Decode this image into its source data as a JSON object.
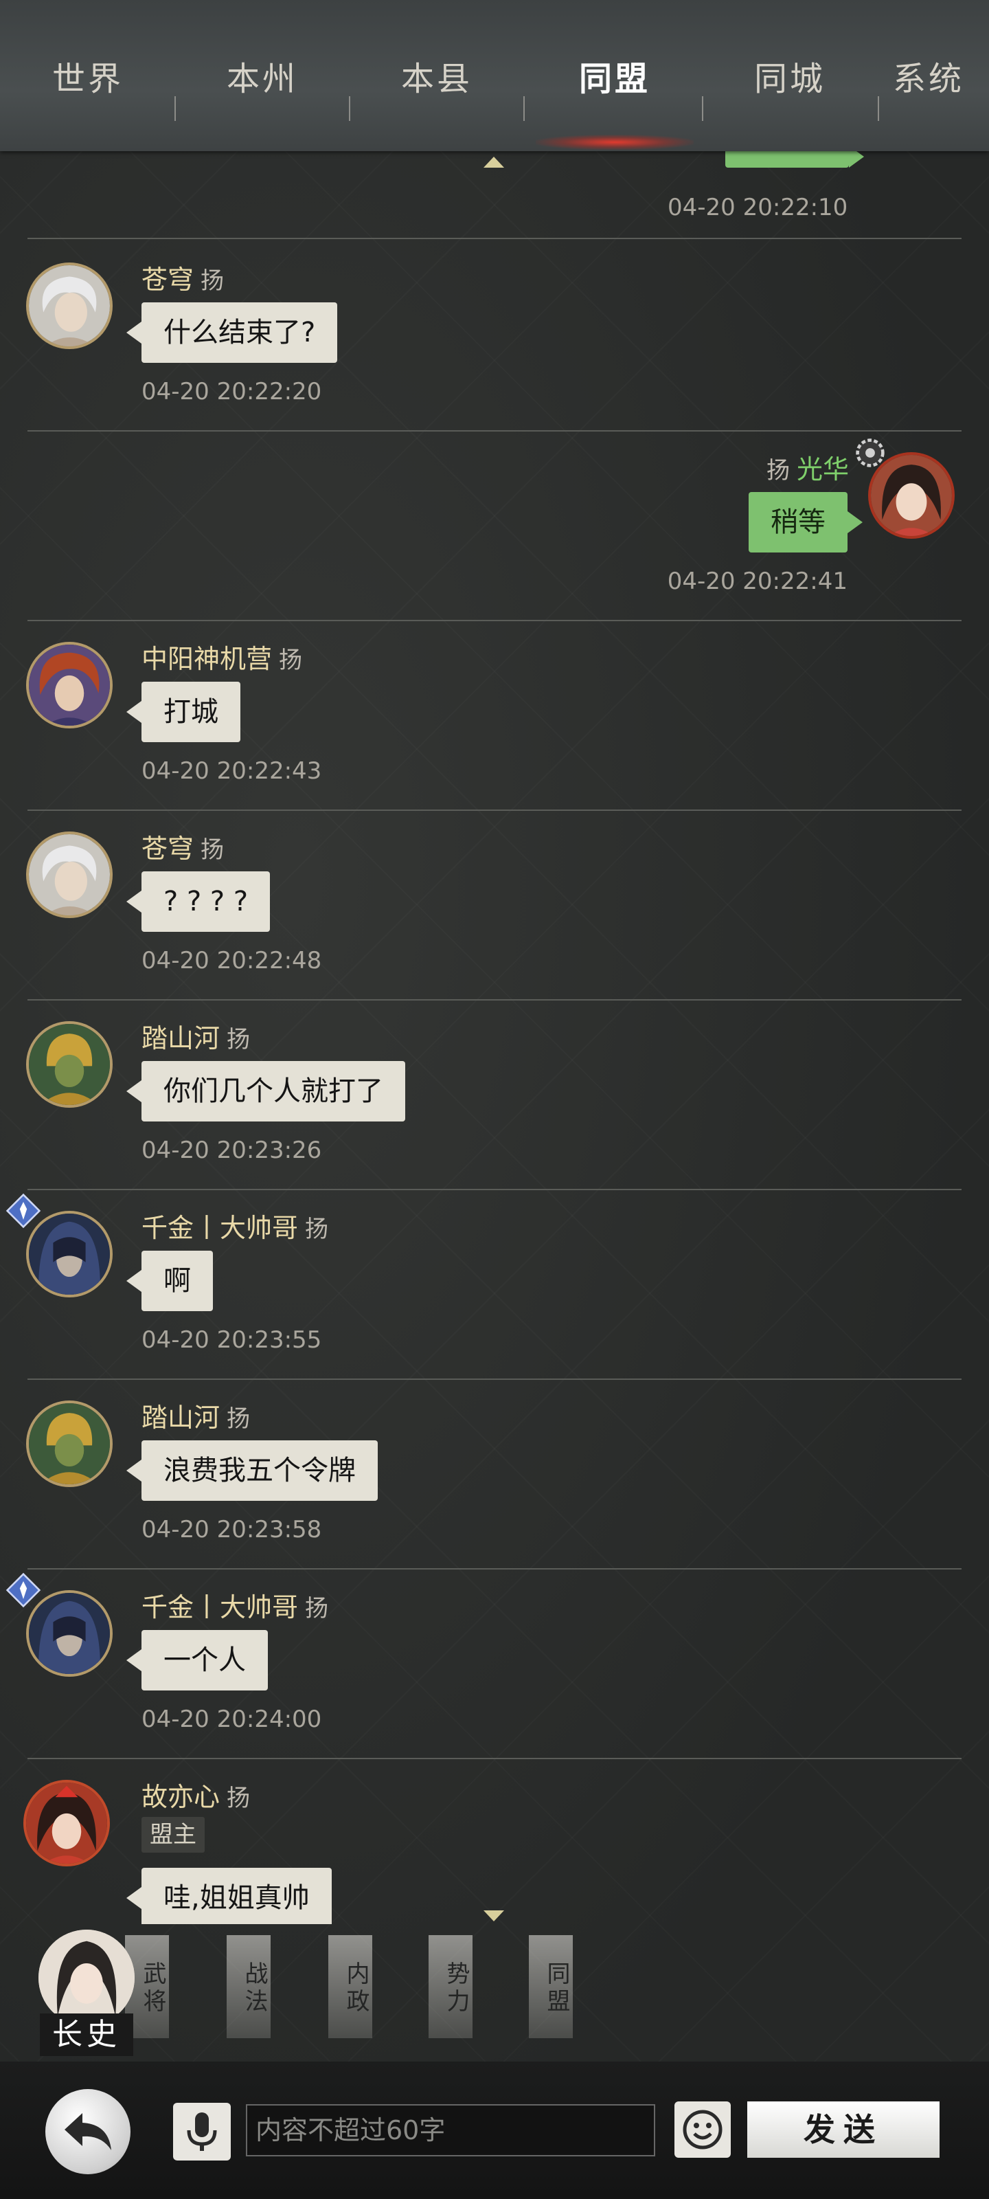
{
  "tabs": [
    {
      "label": "世界",
      "active": false
    },
    {
      "label": "本州",
      "active": false
    },
    {
      "label": "本县",
      "active": false
    },
    {
      "label": "同盟",
      "active": true
    },
    {
      "label": "同城",
      "active": false
    },
    {
      "label": "系统",
      "active": false
    }
  ],
  "top_partial": {
    "time": "04-20 20:22:10"
  },
  "messages": [
    {
      "name": "苍穹",
      "tag": "扬",
      "text": "什么结束了?",
      "time": "04-20 20:22:20",
      "mine": false,
      "avatar": "silver-hair-hero"
    },
    {
      "name": "光华",
      "tag": "扬",
      "text": "稍等",
      "time": "04-20 20:22:41",
      "mine": true,
      "avatar": "dark-hair-heroine"
    },
    {
      "name": "中阳神机营",
      "tag": "扬",
      "text": "打城",
      "time": "04-20 20:22:43",
      "mine": false,
      "avatar": "red-hair-hero"
    },
    {
      "name": "苍穹",
      "tag": "扬",
      "text": "? ? ? ?",
      "time": "04-20 20:22:48",
      "mine": false,
      "avatar": "silver-hair-hero"
    },
    {
      "name": "踏山河",
      "tag": "扬",
      "text": "你们几个人就打了",
      "time": "04-20 20:23:26",
      "mine": false,
      "avatar": "golden-armor-hero"
    },
    {
      "name": "千金丨大帅哥",
      "tag": "扬",
      "text": "啊",
      "time": "04-20 20:23:55",
      "mine": false,
      "avatar": "hooded-hero"
    },
    {
      "name": "踏山河",
      "tag": "扬",
      "text": "浪费我五个令牌",
      "time": "04-20 20:23:58",
      "mine": false,
      "avatar": "golden-armor-hero"
    },
    {
      "name": "千金丨大帅哥",
      "tag": "扬",
      "text": "一个人",
      "time": "04-20 20:24:00",
      "mine": false,
      "avatar": "hooded-hero"
    },
    {
      "name": "故亦心",
      "tag": "扬",
      "role": "盟主",
      "text": "哇,姐姐真帅",
      "time": "",
      "mine": false,
      "avatar": "red-crown-heroine"
    }
  ],
  "character": {
    "label": "长史"
  },
  "menu": [
    "武将",
    "战法",
    "内政",
    "势力",
    "同盟"
  ],
  "input": {
    "placeholder": "内容不超过60字",
    "value": ""
  },
  "send_label": "发送",
  "colors": {
    "bubble": "#e4e1d6",
    "mine_bubble": "#7ec16f",
    "name": "#e9d9a8",
    "mine_name": "#7fd06b",
    "active_tab_glow": "#e03a2e"
  }
}
